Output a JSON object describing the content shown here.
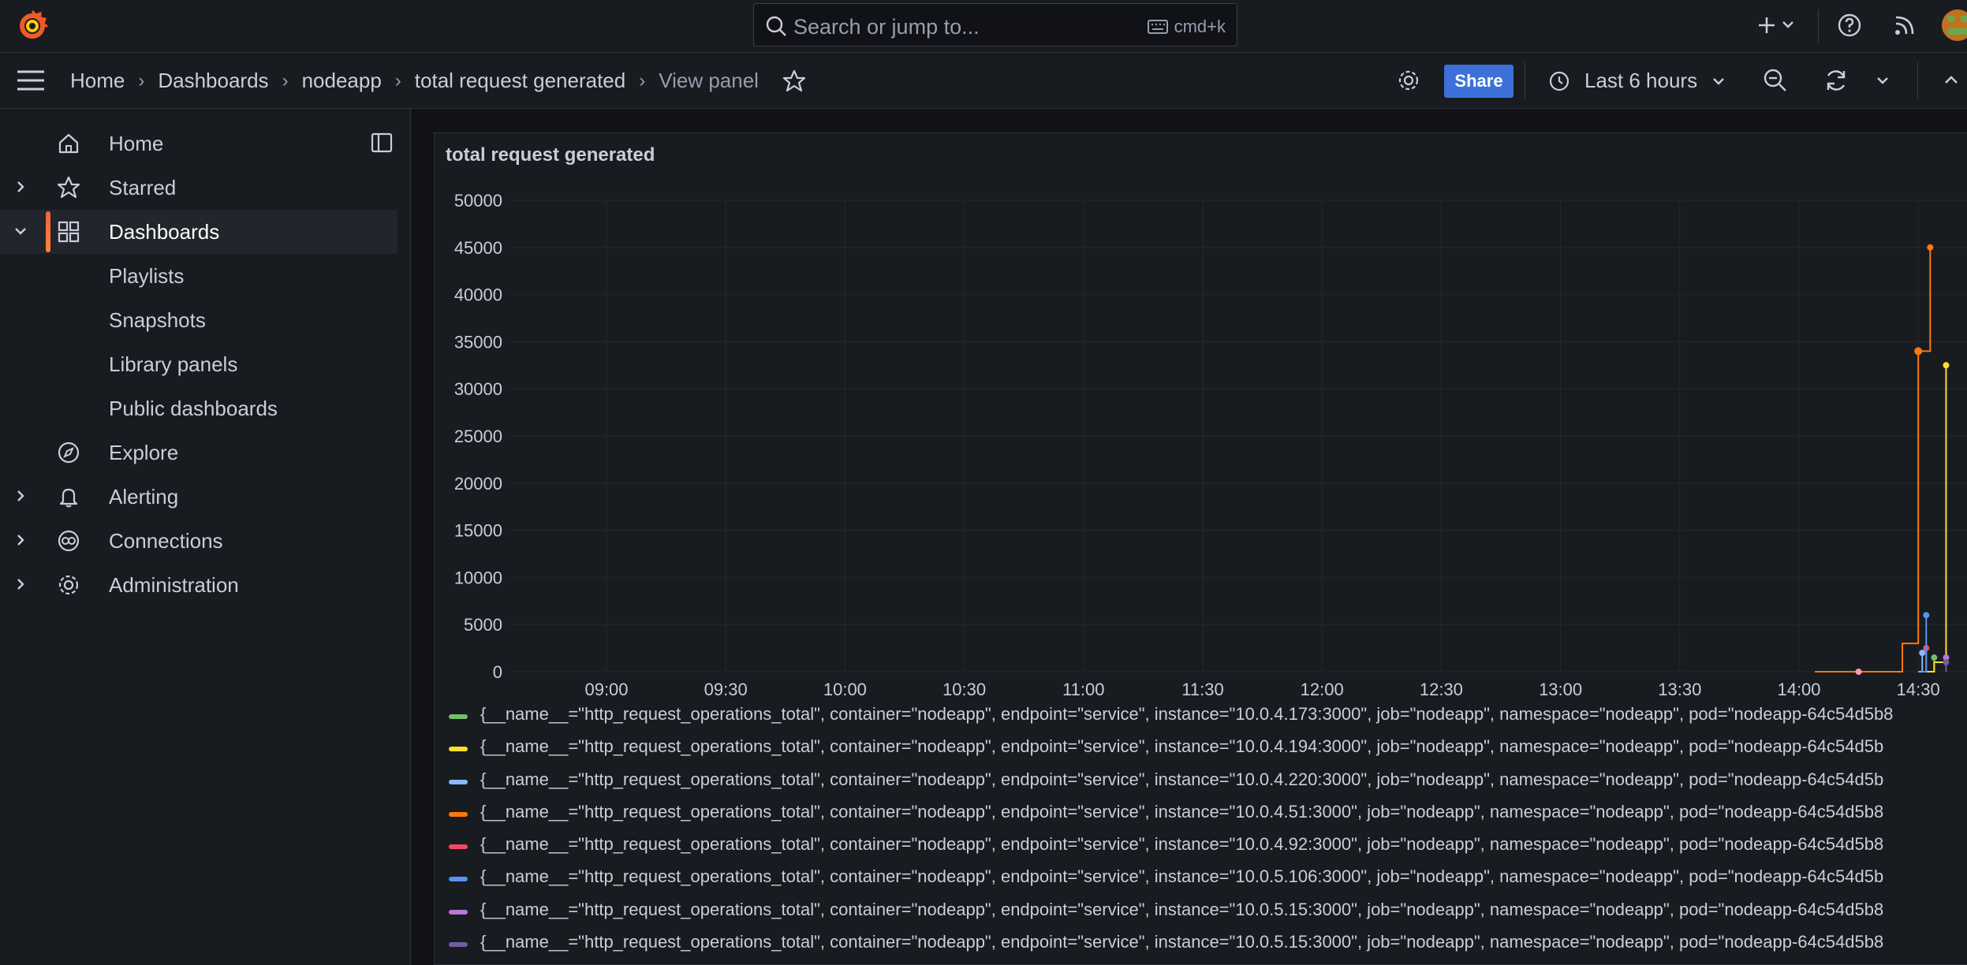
{
  "search": {
    "placeholder": "Search or jump to...",
    "shortcut": "cmd+k"
  },
  "breadcrumb": [
    "Home",
    "Dashboards",
    "nodeapp",
    "total request generated",
    "View panel"
  ],
  "toolbar": {
    "share_label": "Share",
    "time_range": "Last 6 hours"
  },
  "sidebar": {
    "items": [
      {
        "label": "Home",
        "icon": "home-icon"
      },
      {
        "label": "Starred",
        "icon": "star-icon"
      },
      {
        "label": "Dashboards",
        "icon": "apps-icon"
      },
      {
        "label": "Playlists"
      },
      {
        "label": "Snapshots"
      },
      {
        "label": "Library panels"
      },
      {
        "label": "Public dashboards"
      },
      {
        "label": "Explore",
        "icon": "compass-icon"
      },
      {
        "label": "Alerting",
        "icon": "bell-icon"
      },
      {
        "label": "Connections",
        "icon": "connections-icon"
      },
      {
        "label": "Administration",
        "icon": "gear-icon"
      }
    ]
  },
  "colors": {
    "accent": "#3d71d9",
    "brand": "#f05a28",
    "active_bar": "#f55f3e"
  },
  "chart_data": {
    "type": "line",
    "title": "total request generated",
    "ylim": [
      0,
      50000
    ],
    "y_ticks": [
      "50000",
      "45000",
      "40000",
      "35000",
      "30000",
      "25000",
      "20000",
      "15000",
      "10000",
      "5000",
      "0"
    ],
    "x_ticks": [
      "09:00",
      "09:30",
      "10:00",
      "10:30",
      "11:00",
      "11:30",
      "12:00",
      "12:30",
      "13:00",
      "13:30",
      "14:00",
      "14:30"
    ],
    "grid": true,
    "legend_placement": "bottom",
    "series": [
      {
        "name": "{__name__=\"http_request_operations_total\", container=\"nodeapp\", endpoint=\"service\", instance=\"10.0.4.173:3000\", job=\"nodeapp\", namespace=\"nodeapp\", pod=\"nodeapp-64c54d5b8",
        "color": "#73bf69",
        "points": [
          [
            "14:33",
            0
          ],
          [
            "14:34",
            1500
          ]
        ]
      },
      {
        "name": "{__name__=\"http_request_operations_total\", container=\"nodeapp\", endpoint=\"service\", instance=\"10.0.4.194:3000\", job=\"nodeapp\", namespace=\"nodeapp\", pod=\"nodeapp-64c54d5b",
        "color": "#fade2a",
        "points": [
          [
            "14:32",
            0
          ],
          [
            "14:34",
            1000
          ],
          [
            "14:37",
            32500
          ]
        ]
      },
      {
        "name": "{__name__=\"http_request_operations_total\", container=\"nodeapp\", endpoint=\"service\", instance=\"10.0.4.220:3000\", job=\"nodeapp\", namespace=\"nodeapp\", pod=\"nodeapp-64c54d5b",
        "color": "#8ab8ff",
        "points": [
          [
            "14:30",
            0
          ],
          [
            "14:31",
            2000
          ]
        ]
      },
      {
        "name": "{__name__=\"http_request_operations_total\", container=\"nodeapp\", endpoint=\"service\", instance=\"10.0.4.51:3000\", job=\"nodeapp\", namespace=\"nodeapp\", pod=\"nodeapp-64c54d5b8",
        "color": "#ff780a",
        "points": [
          [
            "14:04",
            0
          ],
          [
            "14:22",
            0
          ],
          [
            "14:26",
            3000
          ],
          [
            "14:30",
            34000
          ],
          [
            "14:33",
            45000
          ]
        ]
      },
      {
        "name": "{__name__=\"http_request_operations_total\", container=\"nodeapp\", endpoint=\"service\", instance=\"10.0.4.92:3000\", job=\"nodeapp\", namespace=\"nodeapp\", pod=\"nodeapp-64c54d5b8",
        "color": "#f2495c",
        "points": [
          [
            "14:31",
            0
          ],
          [
            "14:32",
            2500
          ]
        ]
      },
      {
        "name": "{__name__=\"http_request_operations_total\", container=\"nodeapp\", endpoint=\"service\", instance=\"10.0.5.106:3000\", job=\"nodeapp\", namespace=\"nodeapp\", pod=\"nodeapp-64c54d5b",
        "color": "#5794f2",
        "points": [
          [
            "14:31",
            0
          ],
          [
            "14:32",
            6000
          ]
        ]
      },
      {
        "name": "{__name__=\"http_request_operations_total\", container=\"nodeapp\", endpoint=\"service\", instance=\"10.0.5.15:3000\", job=\"nodeapp\", namespace=\"nodeapp\", pod=\"nodeapp-64c54d5b8",
        "color": "#b877d9",
        "points": [
          [
            "14:37",
            500
          ],
          [
            "14:37",
            1500
          ]
        ]
      },
      {
        "name": "{__name__=\"http_request_operations_total\", container=\"nodeapp\", endpoint=\"service\", instance=\"10.0.5.15:3000\", job=\"nodeapp\", namespace=\"nodeapp\", pod=\"nodeapp-64c54d5b8",
        "color": "#705da0",
        "points": [
          [
            "14:37",
            0
          ],
          [
            "14:37",
            1000
          ]
        ]
      }
    ]
  }
}
